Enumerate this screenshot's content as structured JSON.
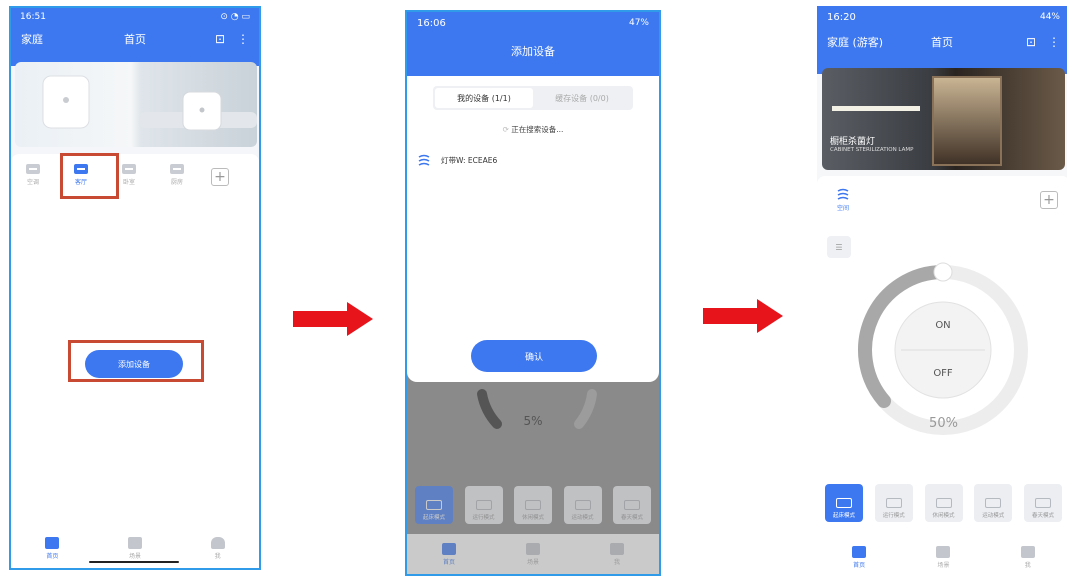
{
  "screen1": {
    "time": "16:51",
    "status_icons": "⊙ ◔ ▭",
    "home_label": "家庭",
    "title": "首页",
    "rooms": [
      "空调",
      "客厅",
      "卧室",
      "厨房"
    ],
    "add_device_button": "添加设备",
    "nav": [
      "首页",
      "场景",
      "我"
    ]
  },
  "screen2": {
    "time": "16:06",
    "status_right": "47%",
    "title": "添加设备",
    "tab_my_devices": "我的设备 (1/1)",
    "tab_cached": "缓存设备 (0/0)",
    "searching": "正在搜索设备...",
    "device_name": "灯带W: ECEAE6",
    "confirm": "确认",
    "bg_percent": "5%",
    "modes": [
      "起床模式",
      "运行模式",
      "休闲模式",
      "运动模式",
      "春天模式"
    ],
    "nav": [
      "首页",
      "场景",
      "我"
    ]
  },
  "screen3": {
    "time": "16:20",
    "status_right": "44%",
    "home_label": "家庭 (游客)",
    "title": "首页",
    "banner_title": "橱柜杀菌灯",
    "banner_subtitle": "CABINET STERILIZATION LAMP",
    "room": "空间",
    "on_label": "ON",
    "off_label": "OFF",
    "percent": "50%",
    "level": 0.5,
    "modes": [
      "起床模式",
      "运行模式",
      "休闲模式",
      "运动模式",
      "春天模式"
    ],
    "nav": [
      "首页",
      "场景",
      "我"
    ]
  },
  "colors": {
    "primary": "#3d78f0",
    "frame": "#2f9be9",
    "arrow": "#e8141c",
    "highlight": "#c94a33"
  }
}
